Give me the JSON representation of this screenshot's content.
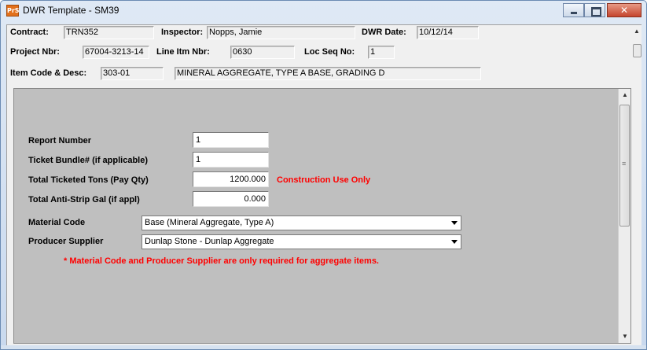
{
  "window": {
    "title": "DWR Template - SM39",
    "app_icon_text": "PrS",
    "buttons": [
      "minimize",
      "maximize",
      "close"
    ]
  },
  "header": {
    "contract_label": "Contract:",
    "contract_value": "TRN352",
    "inspector_label": "Inspector:",
    "inspector_value": "Nopps, Jamie",
    "dwr_date_label": "DWR Date:",
    "dwr_date_value": "10/12/14",
    "project_nbr_label": "Project Nbr:",
    "project_nbr_value": "67004-3213-14",
    "line_itm_label": "Line Itm Nbr:",
    "line_itm_value": "0630",
    "loc_seq_label": "Loc Seq No:",
    "loc_seq_value": "1",
    "item_code_label": "Item Code & Desc:",
    "item_code_value": "303-01",
    "item_desc_value": "MINERAL AGGREGATE, TYPE A BASE, GRADING D"
  },
  "form": {
    "report_number_label": "Report Number",
    "report_number_value": "1",
    "ticket_bundle_label": "Ticket Bundle# (if applicable)",
    "ticket_bundle_value": "1",
    "total_tons_label": "Total Ticketed Tons (Pay Qty)",
    "total_tons_value": "1200.000",
    "construction_note": "Construction Use Only",
    "anti_strip_label": "Total Anti-Strip Gal (if appl)",
    "anti_strip_value": "0.000",
    "material_code_label": "Material Code",
    "material_code_value": "Base (Mineral Aggregate, Type A)",
    "producer_supplier_label": "Producer Supplier",
    "producer_supplier_value": "Dunlap Stone - Dunlap Aggregate",
    "required_note": "* Material Code and  Producer Supplier are only required for aggregate items."
  },
  "colors": {
    "note_red": "#ff0000",
    "panel_gray": "#bfbfbf"
  }
}
